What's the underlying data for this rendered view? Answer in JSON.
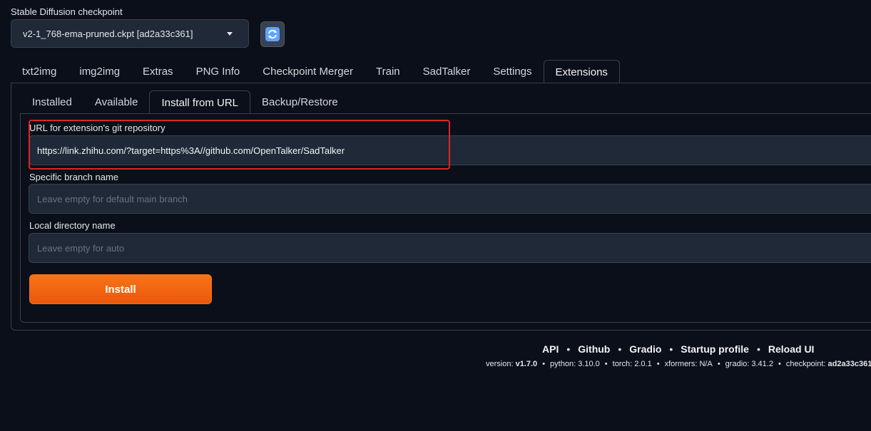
{
  "checkpoint": {
    "label": "Stable Diffusion checkpoint",
    "value": "v2-1_768-ema-pruned.ckpt [ad2a33c361]",
    "refresh_icon": "refresh-icon"
  },
  "main_tabs": [
    {
      "label": "txt2img"
    },
    {
      "label": "img2img"
    },
    {
      "label": "Extras"
    },
    {
      "label": "PNG Info"
    },
    {
      "label": "Checkpoint Merger"
    },
    {
      "label": "Train"
    },
    {
      "label": "SadTalker"
    },
    {
      "label": "Settings"
    },
    {
      "label": "Extensions",
      "active": true
    }
  ],
  "sub_tabs": [
    {
      "label": "Installed"
    },
    {
      "label": "Available"
    },
    {
      "label": "Install from URL",
      "active": true
    },
    {
      "label": "Backup/Restore"
    }
  ],
  "form": {
    "url_label": "URL for extension's git repository",
    "url_value": "https://link.zhihu.com/?target=https%3A//github.com/OpenTalker/SadTalker",
    "branch_label": "Specific branch name",
    "branch_placeholder": "Leave empty for default main branch",
    "dir_label": "Local directory name",
    "dir_placeholder": "Leave empty for auto",
    "install_label": "Install"
  },
  "footer": {
    "links": [
      "API",
      "Github",
      "Gradio",
      "Startup profile",
      "Reload UI"
    ],
    "separator": "•",
    "versions": {
      "version_label": "version:",
      "version": "v1.7.0",
      "python_label": "python:",
      "python": "3.10.0",
      "torch_label": "torch:",
      "torch": "2.0.1",
      "xformers_label": "xformers:",
      "xformers": "N/A",
      "gradio_label": "gradio:",
      "gradio": "3.41.2",
      "checkpoint_label": "checkpoint:",
      "checkpoint": "ad2a33c361"
    }
  },
  "colors": {
    "background": "#0b0f19",
    "accent": "#ea580c",
    "highlight": "#e02424"
  }
}
